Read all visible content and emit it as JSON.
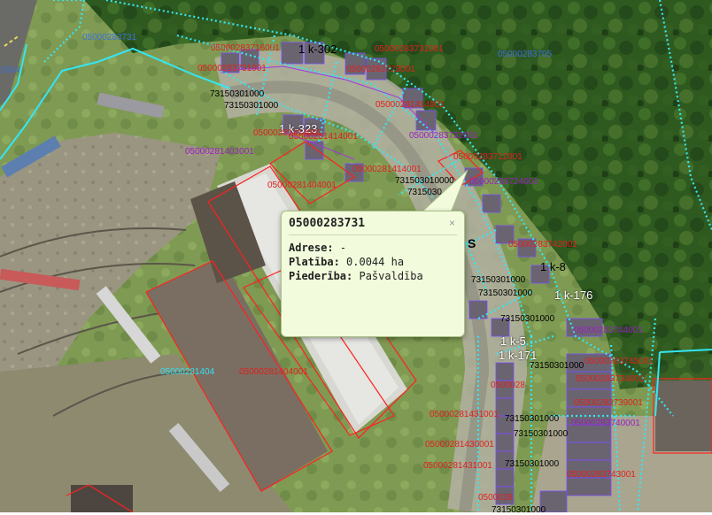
{
  "popup": {
    "title": "05000283731",
    "close": "×",
    "address_label": "Adrese:",
    "address_value": "-",
    "area_label": "Platība:",
    "area_value": "0.0044 ha",
    "ownership_label": "Piederība:",
    "ownership_value": "Pašvaldība"
  },
  "labels": {
    "l01": "05000283731",
    "l02": "1604",
    "l03": "05000283705",
    "l04": "05000283716001",
    "l05": "05000283731001",
    "l06": "05000283731001",
    "l07": "05000283723001",
    "l08": "1 k-302",
    "l09": "73150301000",
    "l10": "73150301000",
    "l11": "1 k-323",
    "l12": "05000281414001",
    "l13": "05000281403001",
    "l14": "05000281414001",
    "l15": "05000281414001",
    "l16": "05000281404001",
    "l17": "05000281414001",
    "l18": "05000283732001",
    "l19": "731503010000",
    "l20": "7315030",
    "l21": "05000283712001",
    "l22": "05000283724001",
    "l23": "S",
    "l24": "05000283742001",
    "l25": "1 k-8",
    "l26": "73150301000",
    "l27": "73150301000",
    "l28": "1 k-176",
    "l29": "73150301000",
    "l30": "05000283744001",
    "l31": "1 k-5",
    "l32": "1 k-171",
    "l33": "05000281404",
    "l34": "05000281404001",
    "l35": "05000281431001",
    "l36": "05000281430001",
    "l37": "05000281431001",
    "l38": "73150301000",
    "l39": "73150301000",
    "l40": "73150301000",
    "l41": "05000283734001",
    "l42": "05000283739001",
    "l43": "05000283740001",
    "l44": "05000283745001",
    "l45": "05000283743001",
    "l46": "0500028",
    "l47": "0500028",
    "l48": "73150301000",
    "l49": "73150301000"
  }
}
